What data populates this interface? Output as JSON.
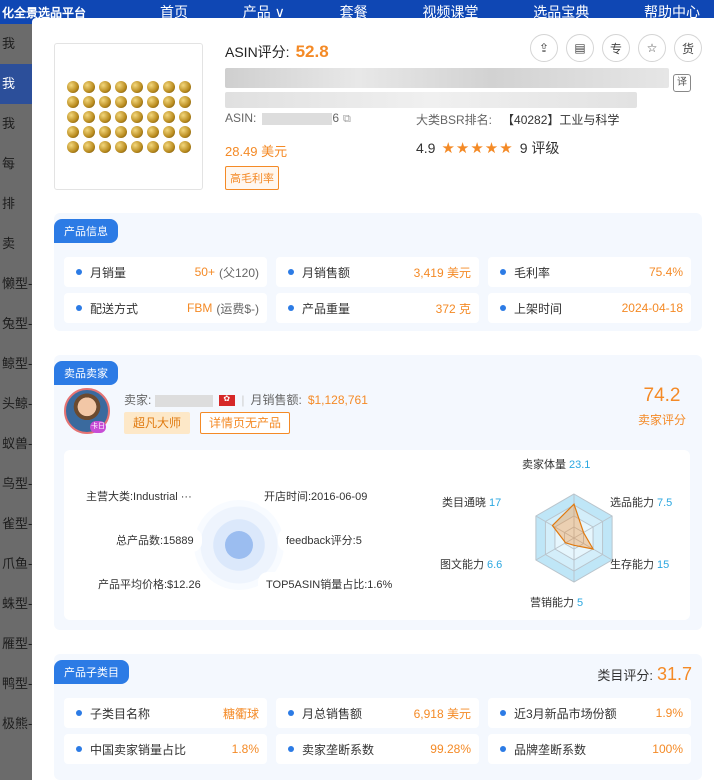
{
  "bg": {
    "logo": "化全景选品平台",
    "menu": [
      "首页",
      "产品 ∨",
      "套餐",
      "视频课堂",
      "选品宝典",
      "帮助中心"
    ],
    "side": [
      "我",
      "我",
      "我",
      "每",
      "排",
      "卖",
      "懒型-",
      "兔型-",
      "鲸型-",
      "头鲸-",
      "蚁兽-",
      "鸟型-",
      "雀型-",
      "爪鱼-",
      "蛛型-",
      "雁型-",
      "鸭型-",
      "极熊-"
    ]
  },
  "product": {
    "asin_score_label": "ASIN评分:",
    "asin_score": "52.8",
    "translate_icon": "译",
    "asin_label": "ASIN:",
    "asin_suffix": "6",
    "bsr_label": "大类BSR排名:",
    "bsr_value": "【40282】工业与科学",
    "price": "28.49 美元",
    "rating": "4.9",
    "stars": "★★★★★",
    "review_count": "9 评级",
    "high_margin_badge": "高毛利率"
  },
  "tools": [
    "⇪",
    "▤",
    "专",
    "☆",
    "货"
  ],
  "product_info": {
    "tag": "产品信息",
    "cells": [
      {
        "label": "月销量",
        "value": "50+",
        "extra": "(父120)"
      },
      {
        "label": "月销售额",
        "value": "3,419 美元",
        "extra": ""
      },
      {
        "label": "毛利率",
        "value": "75.4%",
        "extra": ""
      },
      {
        "label": "配送方式",
        "value": "FBM",
        "extra": "(运费$-)"
      },
      {
        "label": "产品重量",
        "value": "372 克",
        "extra": ""
      },
      {
        "label": "上架时间",
        "value": "2024-04-18",
        "extra": ""
      }
    ]
  },
  "seller": {
    "tag": "卖品卖家",
    "seller_label": "卖家:",
    "month_sales_label": "月销售额:",
    "month_sales": "$1,128,761",
    "badge1": "超凡大师",
    "badge2": "详情页无产品",
    "score": "74.2",
    "score_label": "卖家评分",
    "avatar_tag": "卡日",
    "info": {
      "main_category": "主营大类:Industrial ···",
      "open_time": "开店时间:2016-06-09",
      "total_products": "总产品数:15889",
      "feedback": "feedback评分:5",
      "avg_price": "产品平均价格:$12.26",
      "top5": "TOP5ASIN销量占比:1.6%"
    },
    "radar": [
      {
        "label": "卖家体量",
        "value": "23.1"
      },
      {
        "label": "选品能力",
        "value": "7.5"
      },
      {
        "label": "生存能力",
        "value": "15"
      },
      {
        "label": "营销能力",
        "value": "5"
      },
      {
        "label": "图文能力",
        "value": "6.6"
      },
      {
        "label": "类目通晓",
        "value": "17"
      }
    ]
  },
  "subcategory": {
    "tag": "产品子类目",
    "score_label": "类目评分:",
    "score": "31.7",
    "cells": [
      {
        "label": "子类目名称",
        "value": "糖衢球"
      },
      {
        "label": "月总销售额",
        "value": "6,918 美元"
      },
      {
        "label": "近3月新品市场份额",
        "value": "1.9%"
      },
      {
        "label": "中国卖家销量占比",
        "value": "1.8%"
      },
      {
        "label": "卖家垄断系数",
        "value": "99.28%"
      },
      {
        "label": "品牌垄断系数",
        "value": "100%"
      }
    ]
  }
}
